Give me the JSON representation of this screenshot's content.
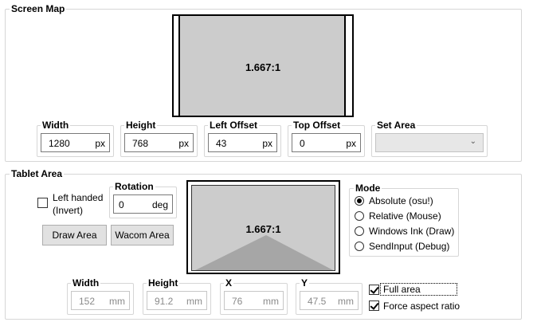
{
  "screen_map": {
    "title": "Screen Map",
    "ratio": "1.667:1",
    "width": {
      "label": "Width",
      "value": "1280",
      "unit": "px"
    },
    "height": {
      "label": "Height",
      "value": "768",
      "unit": "px"
    },
    "left_offset": {
      "label": "Left Offset",
      "value": "43",
      "unit": "px"
    },
    "top_offset": {
      "label": "Top Offset",
      "value": "0",
      "unit": "px"
    },
    "set_area": {
      "label": "Set Area",
      "value": ""
    }
  },
  "tablet_area": {
    "title": "Tablet Area",
    "left_handed_label": "Left handed",
    "invert_label": "(Invert)",
    "left_handed_checked": false,
    "rotation": {
      "label": "Rotation",
      "value": "0",
      "unit": "deg"
    },
    "draw_area_button": "Draw Area",
    "wacom_area_button": "Wacom Area",
    "ratio": "1.667:1",
    "mode": {
      "label": "Mode",
      "options": [
        "Absolute (osu!)",
        "Relative (Mouse)",
        "Windows Ink (Draw)",
        "SendInput (Debug)"
      ],
      "selected_index": 0
    },
    "width": {
      "label": "Width",
      "value": "152",
      "unit": "mm"
    },
    "height": {
      "label": "Height",
      "value": "91.2",
      "unit": "mm"
    },
    "x": {
      "label": "X",
      "value": "76",
      "unit": "mm"
    },
    "y": {
      "label": "Y",
      "value": "47.5",
      "unit": "mm"
    },
    "full_area": {
      "label": "Full area",
      "checked": true
    },
    "force_aspect": {
      "label": "Force aspect ratio",
      "checked": true
    }
  },
  "colors": {
    "preview_fill": "#cccccc",
    "tablet_triangle": "#a6a6a6",
    "border": "#d6d6d6"
  }
}
